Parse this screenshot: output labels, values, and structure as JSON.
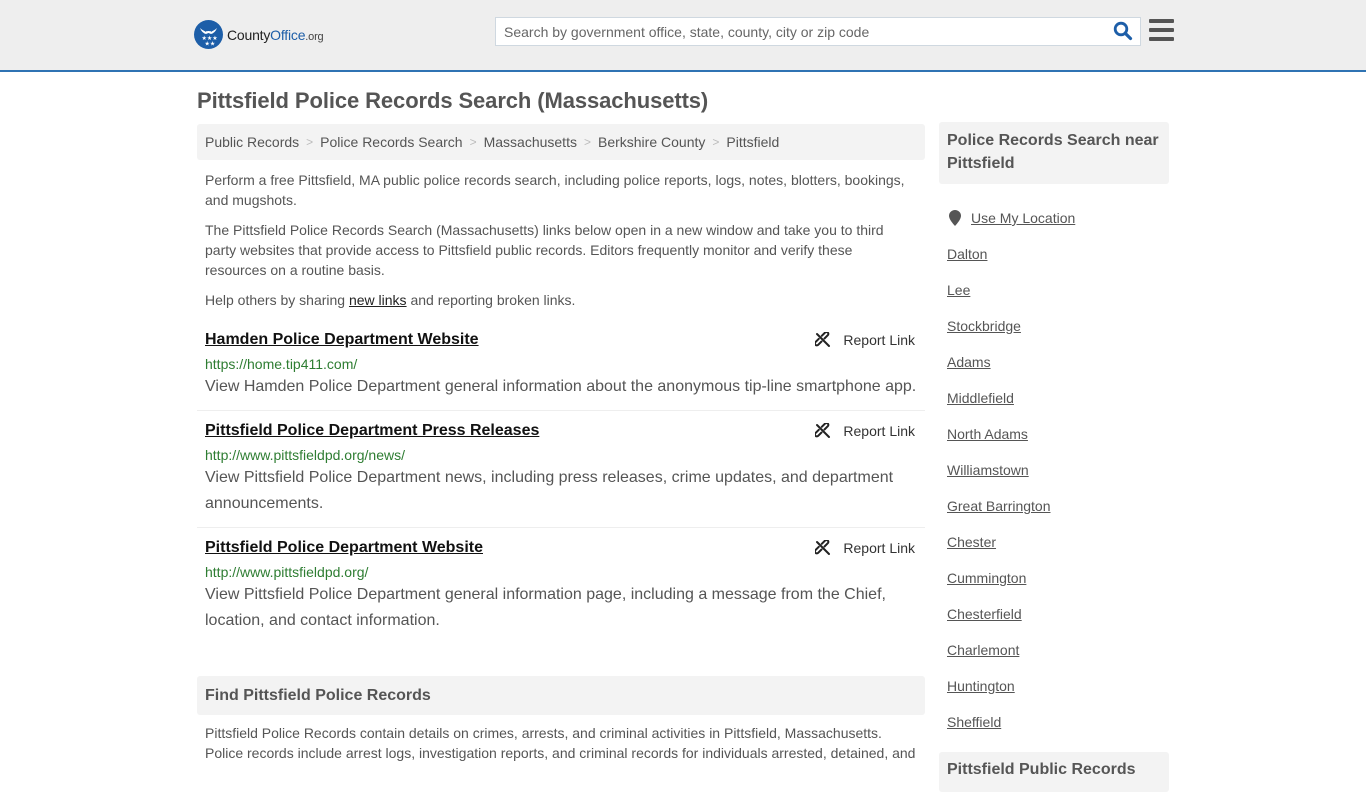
{
  "header": {
    "logo": {
      "name": "County",
      "highlight": "Office",
      "suffix": ".org"
    },
    "search": {
      "placeholder": "Search by government office, state, county, city or zip code",
      "value": ""
    },
    "icons": {
      "search": "search-icon",
      "menu": "hamburger-menu-icon"
    }
  },
  "page": {
    "title": "Pittsfield Police Records Search (Massachusetts)"
  },
  "breadcrumb": [
    {
      "label": "Public Records"
    },
    {
      "label": "Police Records Search"
    },
    {
      "label": "Massachusetts"
    },
    {
      "label": "Berkshire County"
    },
    {
      "label": "Pittsfield"
    }
  ],
  "intro": {
    "p1": "Perform a free Pittsfield, MA public police records search, including police reports, logs, notes, blotters, bookings, and mugshots.",
    "p2": "The Pittsfield Police Records Search (Massachusetts) links below open in a new window and take you to third party websites that provide access to Pittsfield public records. Editors frequently monitor and verify these resources on a routine basis.",
    "p3_before": "Help others by sharing ",
    "p3_link": "new links",
    "p3_after": " and reporting broken links."
  },
  "results": [
    {
      "title": "Hamden Police Department Website",
      "url": "https://home.tip411.com/",
      "description": "View Hamden Police Department general information about the anonymous tip-line smartphone app.",
      "report_label": "Report Link"
    },
    {
      "title": "Pittsfield Police Department Press Releases",
      "url": "http://www.pittsfieldpd.org/news/",
      "description": "View Pittsfield Police Department news, including press releases, crime updates, and department announcements.",
      "report_label": "Report Link"
    },
    {
      "title": "Pittsfield Police Department Website",
      "url": "http://www.pittsfieldpd.org/",
      "description": "View Pittsfield Police Department general information page, including a message from the Chief, location, and contact information.",
      "report_label": "Report Link"
    }
  ],
  "find_section": {
    "heading": "Find Pittsfield Police Records",
    "body": "Pittsfield Police Records contain details on crimes, arrests, and criminal activities in Pittsfield, Massachusetts. Police records include arrest logs, investigation reports, and criminal records for individuals arrested, detained, and"
  },
  "sidebar": {
    "heading": "Police Records Search near Pittsfield",
    "use_location": "Use My Location",
    "nearby": [
      "Dalton",
      "Lee",
      "Stockbridge",
      "Adams",
      "Middlefield",
      "North Adams",
      "Williamstown",
      "Great Barrington",
      "Chester",
      "Cummington",
      "Chesterfield",
      "Charlemont",
      "Huntington",
      "Sheffield"
    ],
    "heading2": "Pittsfield Public Records"
  },
  "colors": {
    "brand_blue": "#1d5ea8",
    "header_border": "#2f73b3",
    "url_green": "#2e7d32",
    "panel_gray": "#f3f3f3"
  }
}
